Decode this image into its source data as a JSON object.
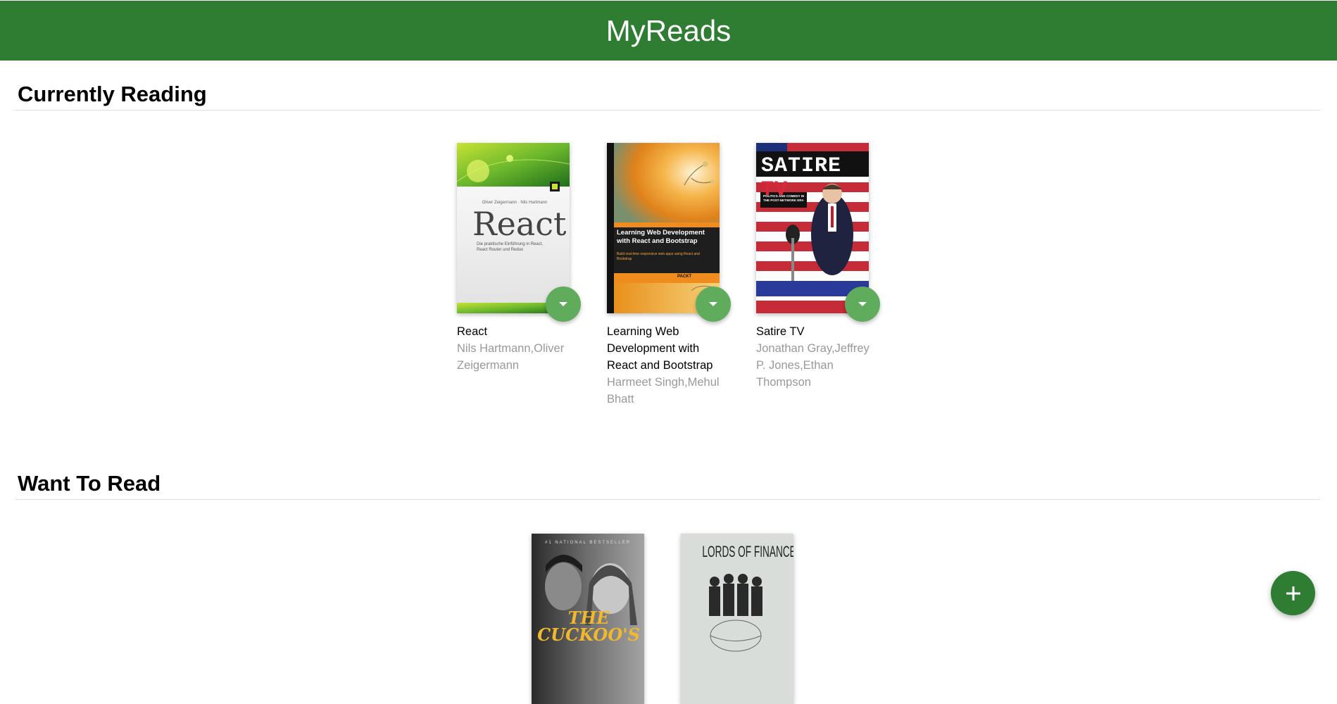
{
  "app": {
    "title": "MyReads"
  },
  "shelves": [
    {
      "title": "Currently Reading",
      "books": [
        {
          "title": "React",
          "authors": "Nils Hartmann,Oliver Zeigermann",
          "cover": {
            "big": "React",
            "small": "Oliver Zeigermann · Nils Hartmann",
            "sub": "Die praktische Einführung in React, React Router und Redux"
          }
        },
        {
          "title": "Learning Web Development with React and Bootstrap",
          "authors": "Harmeet Singh,Mehul Bhatt",
          "cover": {
            "big": "Learning Web Development with React and Bootstrap",
            "sub": "Build real-time responsive web apps using React and Bootstrap",
            "brand": "PACKT"
          }
        },
        {
          "title": "Satire TV",
          "authors": "Jonathan Gray,Jeffrey P. Jones,Ethan Thompson",
          "cover": {
            "big1": "SATIRE",
            "big2": "TV",
            "sub": "POLITICS AND COMEDY IN THE POST-NETWORK ERA"
          }
        }
      ]
    },
    {
      "title": "Want To Read",
      "books": [
        {
          "cover": {
            "top": "#1 NATIONAL BESTSELLER",
            "big": "THE CUCKOO'S"
          }
        },
        {
          "cover": {
            "big": "LORDS OF FINANCE"
          }
        }
      ]
    }
  ],
  "icons": {
    "shelf_changer": "triangle-down-icon",
    "add": "plus-icon"
  },
  "colors": {
    "header": "#2e7d32",
    "shelf_changer": "#60ac5d",
    "author_text": "#999999"
  }
}
